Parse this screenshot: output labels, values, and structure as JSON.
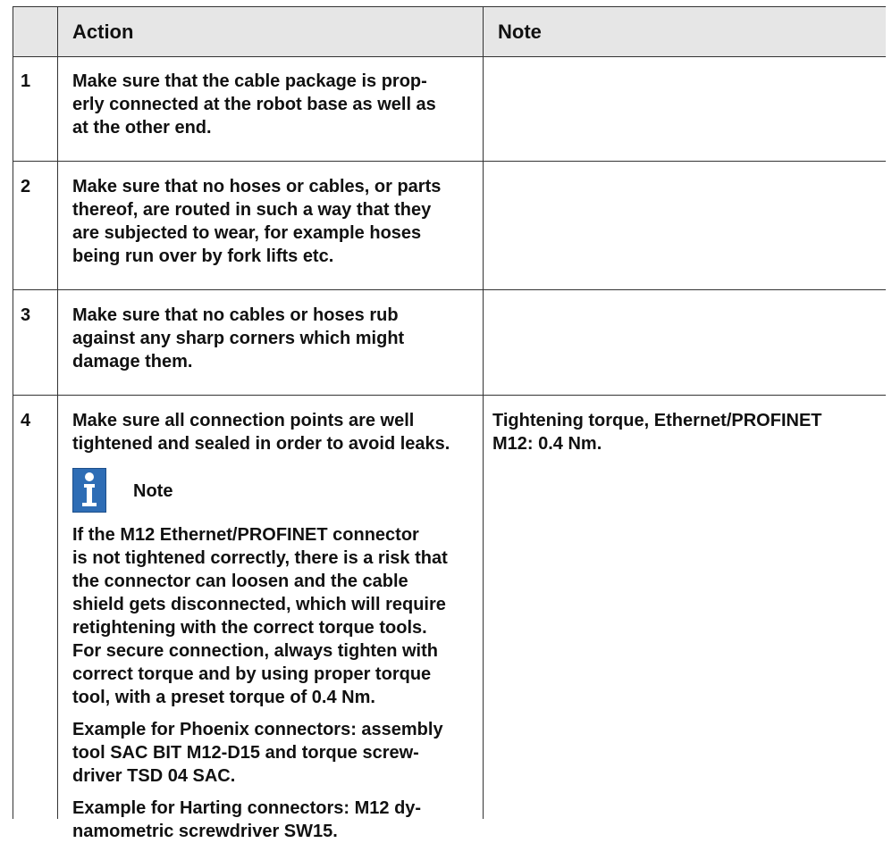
{
  "table": {
    "headers": [
      "",
      "Action",
      "Note"
    ],
    "rows": [
      {
        "num": "1",
        "action_lines": [
          "Make sure that the cable package is prop-",
          "erly connected at the robot base as well as",
          "at the other end."
        ],
        "note": ""
      },
      {
        "num": "2",
        "action_lines": [
          "Make sure that no hoses or cables, or parts",
          "thereof, are routed in such a way that they",
          "are subjected to wear, for example hoses",
          "being run over by fork lifts etc."
        ],
        "note": ""
      },
      {
        "num": "3",
        "action_lines": [
          "Make sure that no cables or hoses rub",
          "against any sharp corners which might",
          "damage them."
        ],
        "note": ""
      },
      {
        "num": "4",
        "action_lines": [
          "Make sure all connection points are well",
          "tightened and sealed in order to avoid leaks."
        ],
        "note_title": "Note",
        "note_icon": "info-icon",
        "note_paragraphs": [
          [
            "If the M12 Ethernet/PROFINET connector",
            "is not tightened correctly, there is a risk that",
            "the connector can loosen and the cable",
            "shield gets disconnected, which will require",
            "retightening with the correct torque tools.",
            "For secure connection, always tighten with",
            "correct torque and by using proper torque",
            "tool, with a preset torque of 0.4 Nm."
          ],
          [
            "Example for Phoenix connectors: assembly",
            "tool SAC BIT M12-D15 and torque screw-",
            "driver TSD 04 SAC."
          ],
          [
            "Example for Harting connectors: M12 dy-",
            "namometric screwdriver SW15."
          ]
        ],
        "note_lines": [
          "Tightening torque, Ethernet/PROFINET",
          "M12: 0.4 Nm."
        ]
      }
    ]
  },
  "colors": {
    "header_bg": "#e6e6e6",
    "icon_blue": "#2e6db5"
  }
}
